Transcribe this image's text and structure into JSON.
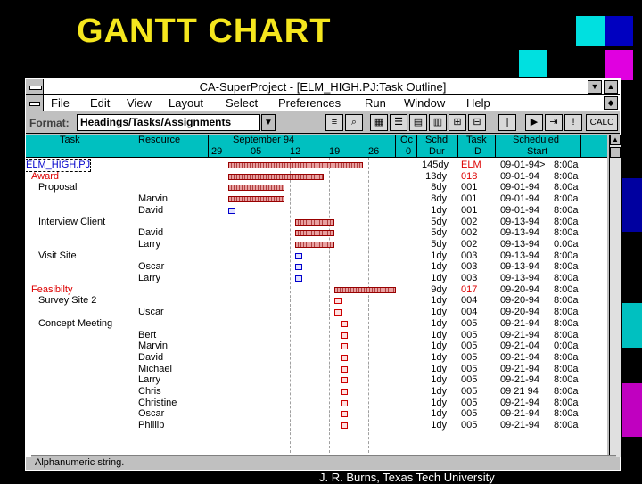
{
  "slide_title": "GANTT CHART",
  "footer": "J. R. Burns, Texas Tech University",
  "colors": {
    "title": "#f5e61e",
    "header_bg": "#00c0c0",
    "bar": "#d87878",
    "accent_cyan": "#00e0e0",
    "accent_blue": "#0000c0",
    "accent_magenta": "#e000e0"
  },
  "window": {
    "title": "CA-SuperProject - [ELM_HIGH.PJ:Task Outline]",
    "menu": [
      "File",
      "Edit",
      "View",
      "Layout",
      "Select",
      "Preferences",
      "Run",
      "Window",
      "Help"
    ],
    "format_label": "Format:",
    "format_value": "Headings/Tasks/Assignments",
    "calc_label": "CALC",
    "status": "Alphanumeric string."
  },
  "columns": {
    "task": "Task",
    "resource": "Resource",
    "timeline_month": "September 94",
    "timeline_days": [
      "29",
      "05",
      "12",
      "19",
      "26"
    ],
    "next_month": "Oc",
    "next_day": "0",
    "schd_dur": [
      "Schd",
      "Dur"
    ],
    "task_id": [
      "Task",
      "ID"
    ],
    "scheduled_start": [
      "Scheduled",
      "Start"
    ]
  },
  "rows": [
    {
      "task": "ELM_HIGH.PJ",
      "resource": "",
      "dur": "145dy",
      "id": "ELM",
      "date": "09-01-94>",
      "time": "8:00a",
      "kind": "root"
    },
    {
      "task": "Award",
      "resource": "",
      "dur": "13dy",
      "id": "018",
      "date": "09-01-94",
      "time": "8:00a",
      "kind": "summary"
    },
    {
      "task": "Proposal",
      "resource": "",
      "dur": "8dy",
      "id": "001",
      "date": "09-01-94",
      "time": "8:00a",
      "kind": "task"
    },
    {
      "task": "",
      "resource": "Marvin",
      "dur": "8dy",
      "id": "001",
      "date": "09-01-94",
      "time": "8:00a",
      "kind": "assign"
    },
    {
      "task": "",
      "resource": "David",
      "dur": "1dy",
      "id": "001",
      "date": "09-01-94",
      "time": "8:00a",
      "kind": "assign"
    },
    {
      "task": "Interview Client",
      "resource": "",
      "dur": "5dy",
      "id": "002",
      "date": "09-13-94",
      "time": "8:00a",
      "kind": "task"
    },
    {
      "task": "",
      "resource": "David",
      "dur": "5dy",
      "id": "002",
      "date": "09-13-94",
      "time": "8:00a",
      "kind": "assign"
    },
    {
      "task": "",
      "resource": "Larry",
      "dur": "5dy",
      "id": "002",
      "date": "09-13-94",
      "time": "0:00a",
      "kind": "assign"
    },
    {
      "task": "Visit Site",
      "resource": "",
      "dur": "1dy",
      "id": "003",
      "date": "09-13-94",
      "time": "8:00a",
      "kind": "task"
    },
    {
      "task": "",
      "resource": "Oscar",
      "dur": "1dy",
      "id": "003",
      "date": "09-13-94",
      "time": "8:00a",
      "kind": "assign"
    },
    {
      "task": "",
      "resource": "Larry",
      "dur": "1dy",
      "id": "003",
      "date": "09-13-94",
      "time": "8:00a",
      "kind": "assign"
    },
    {
      "task": "Feasibilty",
      "resource": "",
      "dur": "9dy",
      "id": "017",
      "date": "09-20-94",
      "time": "8:00a",
      "kind": "summary"
    },
    {
      "task": "Survey Site 2",
      "resource": "",
      "dur": "1dy",
      "id": "004",
      "date": "09-20-94",
      "time": "8:00a",
      "kind": "task"
    },
    {
      "task": "",
      "resource": "Uscar",
      "dur": "1dy",
      "id": "004",
      "date": "09-20-94",
      "time": "8:00a",
      "kind": "assign"
    },
    {
      "task": "Concept Meeting",
      "resource": "",
      "dur": "1dy",
      "id": "005",
      "date": "09-21-94",
      "time": "8:00a",
      "kind": "task"
    },
    {
      "task": "",
      "resource": "Bert",
      "dur": "1dy",
      "id": "005",
      "date": "09-21-94",
      "time": "8:00a",
      "kind": "assign"
    },
    {
      "task": "",
      "resource": "Marvin",
      "dur": "1dy",
      "id": "005",
      "date": "09-21-04",
      "time": "0:00a",
      "kind": "assign"
    },
    {
      "task": "",
      "resource": "David",
      "dur": "1dy",
      "id": "005",
      "date": "09-21-94",
      "time": "8:00a",
      "kind": "assign"
    },
    {
      "task": "",
      "resource": "Michael",
      "dur": "1dy",
      "id": "005",
      "date": "09-21-94",
      "time": "8:00a",
      "kind": "assign"
    },
    {
      "task": "",
      "resource": "Larry",
      "dur": "1dy",
      "id": "005",
      "date": "09-21-94",
      "time": "8:00a",
      "kind": "assign"
    },
    {
      "task": "",
      "resource": "Chris",
      "dur": "1dy",
      "id": "005",
      "date": "09 21 94",
      "time": "8:00a",
      "kind": "assign"
    },
    {
      "task": "",
      "resource": "Christine",
      "dur": "1dy",
      "id": "005",
      "date": "09-21-94",
      "time": "8:00a",
      "kind": "assign"
    },
    {
      "task": "",
      "resource": "Oscar",
      "dur": "1dy",
      "id": "005",
      "date": "09-21-94",
      "time": "8:00a",
      "kind": "assign"
    },
    {
      "task": "",
      "resource": "Phillip",
      "dur": "1dy",
      "id": "005",
      "date": "09-21-94",
      "time": "8:00a",
      "kind": "assign"
    }
  ],
  "gantt": {
    "axis_start": "08-29-94",
    "bars": [
      {
        "start": "09-01-94",
        "days": 24,
        "type": "bar"
      },
      {
        "start": "09-01-94",
        "days": 17,
        "type": "bar"
      },
      {
        "start": "09-01-94",
        "days": 10,
        "type": "bar"
      },
      {
        "start": "09-01-94",
        "days": 10,
        "type": "bar"
      },
      {
        "start": "09-01-94",
        "days": 1,
        "type": "mark"
      },
      {
        "start": "09-13-94",
        "days": 7,
        "type": "bar"
      },
      {
        "start": "09-13-94",
        "days": 7,
        "type": "bar"
      },
      {
        "start": "09-13-94",
        "days": 7,
        "type": "bar"
      },
      {
        "start": "09-13-94",
        "days": 1,
        "type": "mark"
      },
      {
        "start": "09-13-94",
        "days": 1,
        "type": "mark"
      },
      {
        "start": "09-13-94",
        "days": 1,
        "type": "mark"
      },
      {
        "start": "09-20-94",
        "days": 11,
        "type": "bar"
      },
      {
        "start": "09-20-94",
        "days": 1,
        "type": "markred"
      },
      {
        "start": "09-20-94",
        "days": 1,
        "type": "markred"
      },
      {
        "start": "09-21-94",
        "days": 1,
        "type": "markred"
      },
      {
        "start": "09-21-94",
        "days": 1,
        "type": "markred"
      },
      {
        "start": "09-21-94",
        "days": 1,
        "type": "markred"
      },
      {
        "start": "09-21-94",
        "days": 1,
        "type": "markred"
      },
      {
        "start": "09-21-94",
        "days": 1,
        "type": "markred"
      },
      {
        "start": "09-21-94",
        "days": 1,
        "type": "markred"
      },
      {
        "start": "09-21-94",
        "days": 1,
        "type": "markred"
      },
      {
        "start": "09-21-94",
        "days": 1,
        "type": "markred"
      },
      {
        "start": "09-21-94",
        "days": 1,
        "type": "markred"
      },
      {
        "start": "09-21-94",
        "days": 1,
        "type": "markred"
      }
    ]
  }
}
